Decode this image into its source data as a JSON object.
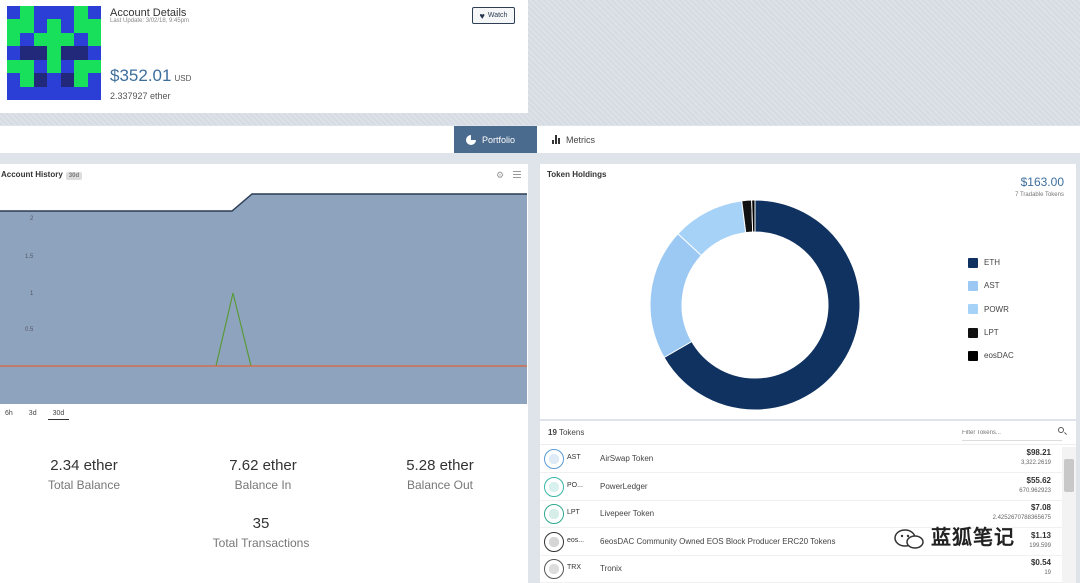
{
  "account": {
    "title": "Account Details",
    "last_update": "Last Update: 3/02/18, 9:45pm",
    "usd_value": "$352.01",
    "usd_unit": "USD",
    "ether_value": "2.337927 ether",
    "watch_label": "Watch"
  },
  "tabs": [
    {
      "label": "Portfolio",
      "active": true
    },
    {
      "label": "Metrics",
      "active": false
    }
  ],
  "history": {
    "title": "Account History",
    "badge": "30d",
    "y_ticks": [
      "2",
      "1.5",
      "1",
      "0.5"
    ],
    "ranges": [
      "6h",
      "3d",
      "30d"
    ],
    "active_range": "30d",
    "stats": [
      {
        "value": "2.34 ether",
        "label": "Total Balance"
      },
      {
        "value": "7.62 ether",
        "label": "Balance In"
      },
      {
        "value": "5.28 ether",
        "label": "Balance Out"
      },
      {
        "value": "35",
        "label": "Total Transactions"
      }
    ]
  },
  "holdings": {
    "title": "Token Holdings",
    "total": "$163.00",
    "tradable": "7 Tradable Tokens",
    "legend": [
      {
        "name": "ETH",
        "color": "#0f3260",
        "share": 0.66
      },
      {
        "name": "AST",
        "color": "#9cc9f3",
        "share": 0.2
      },
      {
        "name": "POWR",
        "color": "#a7d2f7",
        "share": 0.11
      },
      {
        "name": "LPT",
        "color": "#111111",
        "share": 0.015
      },
      {
        "name": "eosDAC",
        "color": "#000000",
        "share": 0.005
      }
    ]
  },
  "tokens": {
    "count": "19",
    "count_label": "Tokens",
    "filter_placeholder": "Filter Tokens...",
    "rows": [
      {
        "symbol": "AST",
        "name": "AirSwap Token",
        "usd": "$98.21",
        "amount": "3,322.2619",
        "logo_color": "#5b9bd5"
      },
      {
        "symbol": "PO...",
        "name": "PowerLedger",
        "usd": "$55.62",
        "amount": "670.962923",
        "logo_color": "#3ab6a8"
      },
      {
        "symbol": "LPT",
        "name": "Livepeer Token",
        "usd": "$7.08",
        "amount": "2.4252670788365675",
        "logo_color": "#2fa88f"
      },
      {
        "symbol": "eos...",
        "name": "6eosDAC Community Owned EOS Block Producer ERC20 Tokens",
        "usd": "$1.13",
        "amount": "199.599",
        "logo_color": "#333333"
      },
      {
        "symbol": "TRX",
        "name": "Tronix",
        "usd": "$0.54",
        "amount": "19",
        "logo_color": "#555555"
      }
    ]
  },
  "watermark": "蓝狐笔记"
}
